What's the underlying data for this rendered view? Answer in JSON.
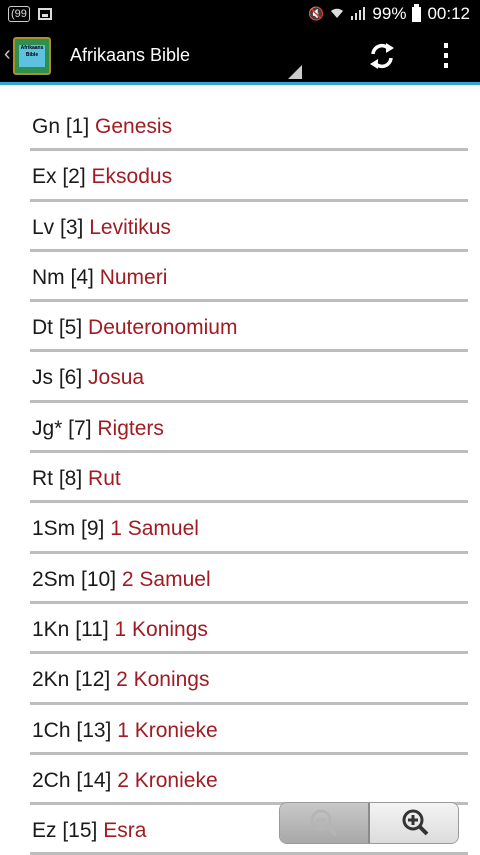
{
  "status_bar": {
    "notification_badge": "(99",
    "battery_percent": "99%",
    "time": "00:12"
  },
  "app_bar": {
    "title": "Afrikaans Bible",
    "icon_text": "Afrikaans Bible"
  },
  "books": [
    {
      "abbr": "Gn [1]",
      "name": "Genesis"
    },
    {
      "abbr": "Ex [2]",
      "name": "Eksodus"
    },
    {
      "abbr": "Lv [3]",
      "name": "Levitikus"
    },
    {
      "abbr": "Nm [4]",
      "name": "Numeri"
    },
    {
      "abbr": "Dt [5]",
      "name": "Deuteronomium"
    },
    {
      "abbr": "Js [6]",
      "name": "Josua"
    },
    {
      "abbr": "Jg* [7]",
      "name": "Rigters"
    },
    {
      "abbr": "Rt [8]",
      "name": "Rut"
    },
    {
      "abbr": "1Sm [9]",
      "name": "1 Samuel"
    },
    {
      "abbr": "2Sm [10]",
      "name": "2 Samuel"
    },
    {
      "abbr": "1Kn [11]",
      "name": "1 Konings"
    },
    {
      "abbr": "2Kn [12]",
      "name": "2 Konings"
    },
    {
      "abbr": "1Ch [13]",
      "name": "1 Kronieke"
    },
    {
      "abbr": "2Ch [14]",
      "name": "2 Kronieke"
    },
    {
      "abbr": "Ez [15]",
      "name": "Esra"
    }
  ],
  "colors": {
    "accent_line": "#33a8d8",
    "book_name": "#a01c22",
    "divider": "#bdbdbd"
  },
  "icons": [
    "back-chevron-icon",
    "app-logo-icon",
    "refresh-icon",
    "overflow-menu-icon",
    "zoom-out-icon",
    "zoom-in-icon",
    "wifi-icon",
    "signal-icon",
    "battery-icon"
  ]
}
